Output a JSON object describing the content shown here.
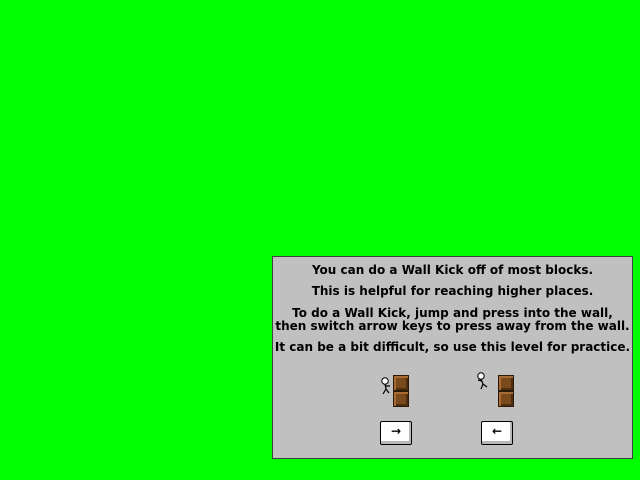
{
  "tutorial": {
    "lines": [
      "You can do a Wall Kick off of most blocks.",
      "This is helpful for reaching higher places.",
      "To do a Wall Kick, jump and press into the wall,",
      "then switch arrow keys to press away from the wall.",
      "It can be a bit difficult, so use this level for practice."
    ]
  },
  "diagram": {
    "step1_key": "→",
    "step2_key": "←"
  },
  "colors": {
    "background": "#00ff00",
    "panel": "#c0c0c0",
    "block": "#7a4a1c"
  }
}
